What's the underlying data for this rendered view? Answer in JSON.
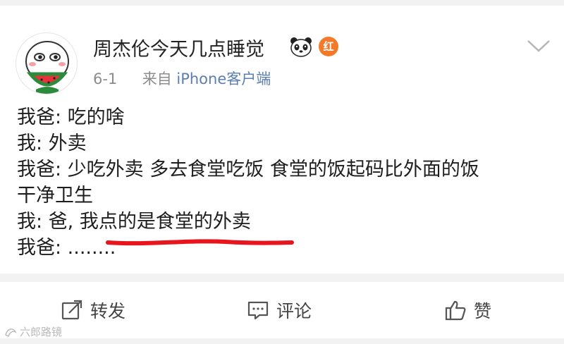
{
  "post": {
    "username": "周杰伦今天几点睡觉",
    "badge_label": "红",
    "date": "6-1",
    "source_prefix": "来自",
    "source": "iPhone客户端",
    "lines": [
      "我爸: 吃的啥",
      "我: 外卖",
      "我爸: 少吃外卖 多去食堂吃饭 食堂的饭起码比外面的饭",
      "干净卫生",
      "我: 爸, 我点的是食堂的外卖",
      "我爸: ........"
    ]
  },
  "actions": {
    "repost_label": "转发",
    "comment_label": "评论",
    "like_label": "赞"
  },
  "watermark": {
    "text": "六郎路镜"
  },
  "colors": {
    "source_link": "#5a7fb0",
    "underline": "#e8141e",
    "badge": "#f27a2a"
  }
}
